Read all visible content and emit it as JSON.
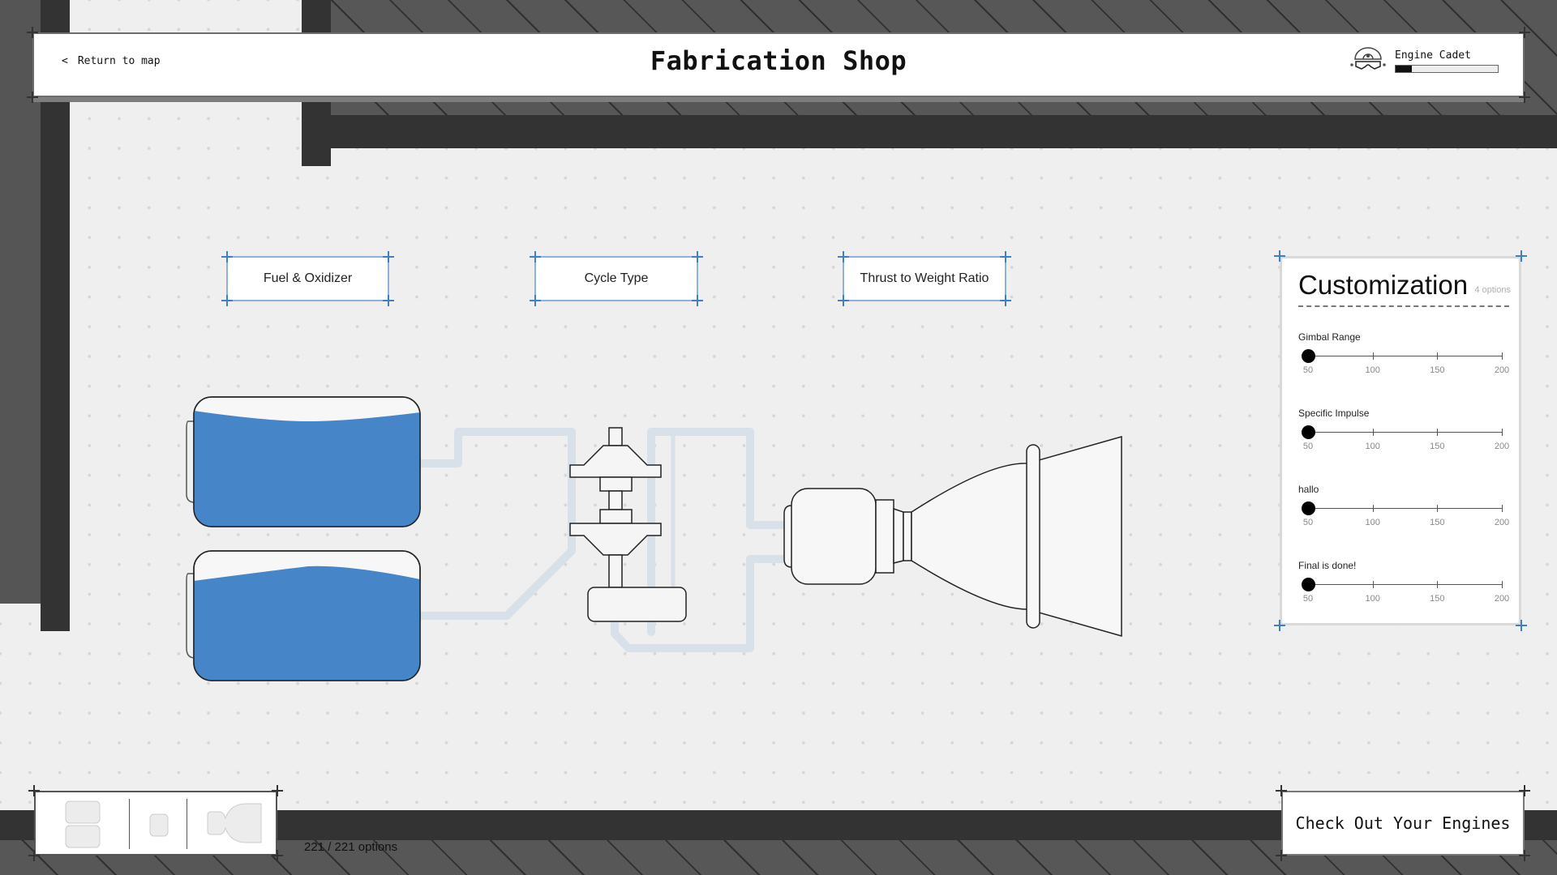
{
  "header": {
    "back_label": "Return to map",
    "back_icon": "chevron-left-icon",
    "back_glyph": "<",
    "title": "Fabrication Shop",
    "rank": {
      "icon": "engineer-goggles-icon",
      "label": "Engine Cadet",
      "progress": 0.16
    }
  },
  "categories": [
    {
      "label": "Fuel & Oxidizer"
    },
    {
      "label": "Cycle Type"
    },
    {
      "label": "Thrust to Weight Ratio"
    }
  ],
  "engine": {
    "tanks": [
      {
        "name": "fuel-tank",
        "fill_color": "#4686c8"
      },
      {
        "name": "oxidizer-tank",
        "fill_color": "#4686c8"
      }
    ],
    "pipe_color": "#d8e0ea"
  },
  "customization": {
    "title": "Customization",
    "count_label": "4 options",
    "sliders": [
      {
        "label": "Gimbal Range",
        "value": 50,
        "min": 50,
        "max": 200,
        "ticks": [
          "50",
          "100",
          "150",
          "200"
        ]
      },
      {
        "label": "Specific Impulse",
        "value": 50,
        "min": 50,
        "max": 200,
        "ticks": [
          "50",
          "100",
          "150",
          "200"
        ]
      },
      {
        "label": "hallo",
        "value": 50,
        "min": 50,
        "max": 200,
        "ticks": [
          "50",
          "100",
          "150",
          "200"
        ]
      },
      {
        "label": "Final is done!",
        "value": 50,
        "min": 50,
        "max": 200,
        "ticks": [
          "50",
          "100",
          "150",
          "200"
        ]
      }
    ]
  },
  "footer": {
    "tray_items": [
      {
        "icon": "tanks-icon"
      },
      {
        "icon": "pump-icon"
      },
      {
        "icon": "nozzle-icon"
      }
    ],
    "options_count": "221 / 221 options",
    "checkout_label": "Check Out Your Engines"
  }
}
